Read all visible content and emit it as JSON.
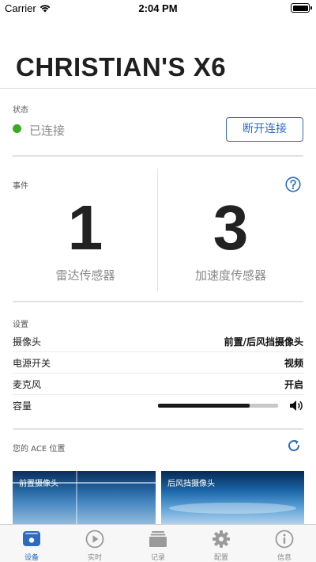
{
  "status_bar": {
    "carrier": "Carrier",
    "time": "2:04 PM"
  },
  "device": {
    "title": "CHRISTIAN'S X6"
  },
  "status": {
    "section_label": "状态",
    "connection_text": "已连接",
    "connection_color": "#3aaa1f",
    "disconnect_label": "断开连接"
  },
  "events": {
    "section_label": "事件",
    "help_icon": "question-circle-icon",
    "items": [
      {
        "count": "1",
        "label": "雷达传感器"
      },
      {
        "count": "3",
        "label": "加速度传感器"
      }
    ]
  },
  "settings": {
    "section_label": "设置",
    "rows": [
      {
        "name": "摄像头",
        "value": "前置/后风挡摄像头"
      },
      {
        "name": "电源开关",
        "value": "视频"
      },
      {
        "name": "麦克风",
        "value": "开启"
      }
    ],
    "volume": {
      "name": "容量",
      "level": 0.76
    }
  },
  "position": {
    "section_label": "您的 ACE 位置",
    "front_camera_label": "前置摄像头",
    "rear_camera_label": "后风挡摄像头"
  },
  "tabs": [
    {
      "label": "设备",
      "icon": "device-icon",
      "active": true
    },
    {
      "label": "实时",
      "icon": "play-icon",
      "active": false
    },
    {
      "label": "记录",
      "icon": "records-icon",
      "active": false
    },
    {
      "label": "配置",
      "icon": "gear-icon",
      "active": false
    },
    {
      "label": "信息",
      "icon": "info-icon",
      "active": false
    }
  ],
  "colors": {
    "accent": "#2c6cbf",
    "connected": "#3aaa1f"
  }
}
